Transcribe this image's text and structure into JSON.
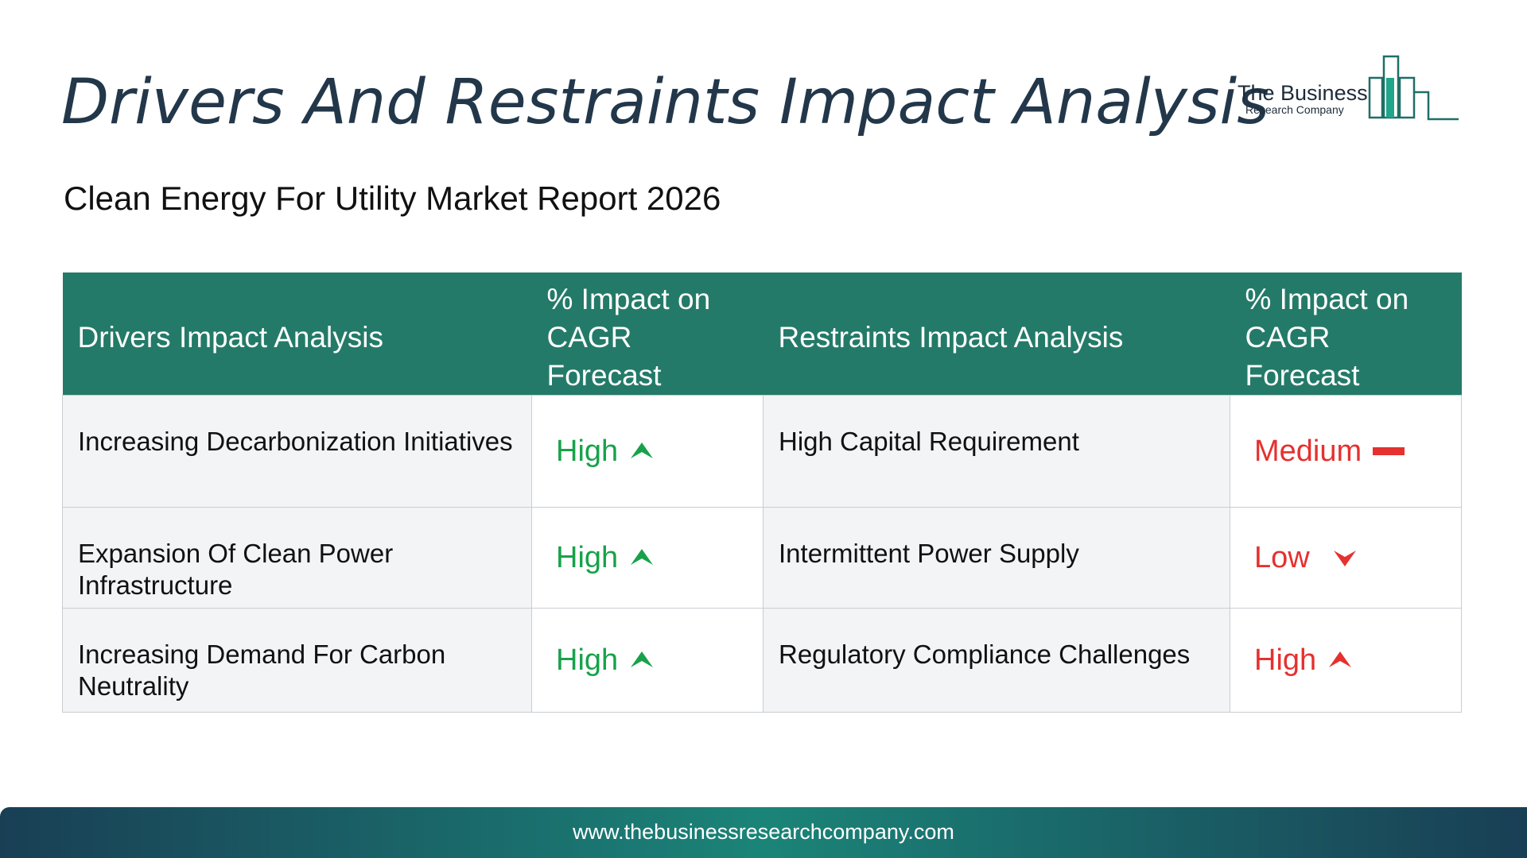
{
  "title": "Drivers And Restraints Impact Analysis",
  "subtitle": "Clean Energy For Utility Market Report 2026",
  "logo": {
    "line1": "The Business",
    "line2": "Research Company"
  },
  "table": {
    "headers": [
      "Drivers Impact Analysis",
      "% Impact on CAGR Forecast",
      "Restraints Impact Analysis",
      "% Impact on CAGR Forecast"
    ],
    "rows": [
      {
        "driver": "Increasing Decarbonization Initiatives",
        "driver_impact": "High",
        "driver_icon": "arrow-up-icon",
        "restraint": "High Capital Requirement",
        "restraint_impact": "Medium",
        "restraint_icon": "dash-icon"
      },
      {
        "driver": "Expansion Of Clean Power Infrastructure",
        "driver_impact": "High",
        "driver_icon": "arrow-up-icon",
        "restraint": "Intermittent Power Supply",
        "restraint_impact": "Low",
        "restraint_icon": "arrow-down-icon"
      },
      {
        "driver": "Increasing Demand For Carbon Neutrality",
        "driver_impact": "High",
        "driver_icon": "arrow-up-icon",
        "restraint": "Regulatory Compliance Challenges",
        "restraint_impact": "High",
        "restraint_icon": "arrow-up-icon"
      }
    ]
  },
  "colors": {
    "header": "#247a68",
    "positive": "#17a24a",
    "negative": "#e5312f",
    "title": "#23374a"
  },
  "footer": {
    "url": "www.thebusinessresearchcompany.com"
  }
}
